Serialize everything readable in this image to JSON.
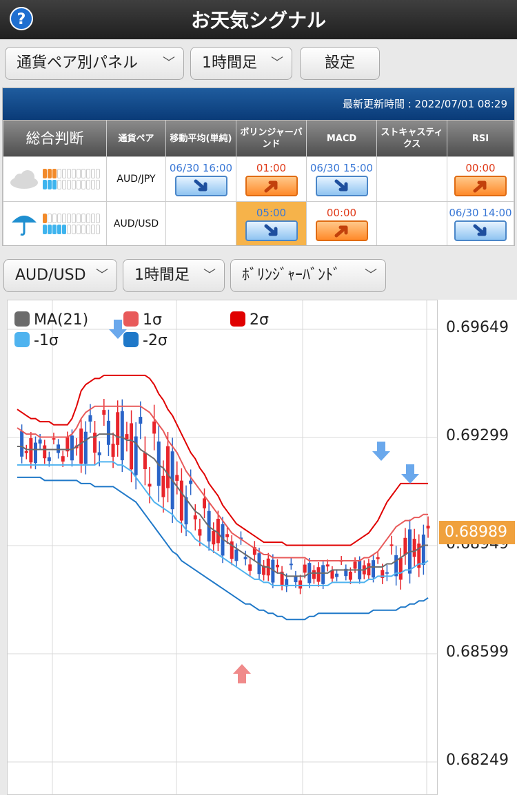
{
  "app": {
    "title": "お天気シグナル",
    "help_icon": "?"
  },
  "controls": {
    "panel_select": "通貨ペア別パネル",
    "timeframe_select": "1時間足",
    "settings_button": "設定"
  },
  "panel": {
    "update_time": "最新更新時間 : 2022/07/01 08:29",
    "headers": {
      "overall": "総合判断",
      "pair": "通貨ペア",
      "ma": "移動平均(単純)",
      "bb": "ボリンジャーバンド",
      "macd": "MACD",
      "stoch": "ストキャスティクス",
      "rsi": "RSI"
    },
    "rows": [
      {
        "weather": "cloud-icon",
        "pair": "AUD/JPY",
        "ma_time": "06/30 16:00",
        "bb_time": "01:00",
        "macd_time": "06/30 15:00",
        "stoch_time": "",
        "rsi_time": "00:00"
      },
      {
        "weather": "umbrella-icon",
        "pair": "AUD/USD",
        "ma_time": "",
        "bb_time": "05:00",
        "macd_time": "00:00",
        "stoch_time": "",
        "rsi_time": "06/30 14:00"
      }
    ]
  },
  "chart_controls": {
    "pair_select": "AUD/USD",
    "timeframe_select": "1時間足",
    "indicator_select": "ﾎﾞﾘﾝｼﾞｬｰﾊﾞﾝﾄﾞ"
  },
  "chart_data": {
    "type": "line",
    "legend": [
      "MA(21)",
      "1σ",
      "2σ",
      "-1σ",
      "-2σ"
    ],
    "legend_colors": [
      "#6b6b6b",
      "#e85a5a",
      "#e00000",
      "#4fb3ef",
      "#1f78c8"
    ],
    "y_ticks": [
      "0.69649",
      "0.69299",
      "0.68949",
      "0.68599",
      "0.68249"
    ],
    "current_price": "0.68989",
    "ylim": [
      0.68249,
      0.69649
    ],
    "x": [
      0,
      2,
      4,
      6,
      8,
      10,
      12,
      14,
      16,
      18,
      20,
      22,
      24,
      26,
      28,
      30,
      32,
      34,
      36,
      38,
      40,
      42,
      44,
      46,
      48,
      50,
      52,
      54,
      56,
      58,
      60,
      62,
      64,
      66,
      68,
      70,
      72,
      74,
      76,
      78,
      80,
      82,
      84,
      86,
      88,
      90,
      92,
      94,
      96,
      98,
      100,
      102,
      104,
      106,
      108,
      110,
      112,
      114,
      116,
      118,
      120,
      122,
      124,
      126,
      128,
      130,
      132,
      134,
      136,
      138,
      140,
      142,
      144,
      146,
      148,
      150,
      152,
      154,
      156,
      158,
      160,
      162,
      164,
      166,
      168,
      170,
      172,
      174,
      176,
      178,
      180
    ],
    "series": [
      {
        "name": "MA(21)",
        "values": [
          0.6927,
          0.6927,
          0.6926,
          0.6926,
          0.6926,
          0.6926,
          0.6926,
          0.6926,
          0.6926,
          0.6926,
          0.6926,
          0.6926,
          0.6926,
          0.6927,
          0.6928,
          0.6929,
          0.693,
          0.693,
          0.6931,
          0.6931,
          0.6931,
          0.6931,
          0.693,
          0.693,
          0.6929,
          0.6929,
          0.6928,
          0.6926,
          0.6925,
          0.6924,
          0.6923,
          0.6921,
          0.692,
          0.6918,
          0.6916,
          0.6914,
          0.6912,
          0.691,
          0.6908,
          0.6906,
          0.6905,
          0.6903,
          0.6901,
          0.69,
          0.6899,
          0.6897,
          0.6896,
          0.6895,
          0.6894,
          0.6893,
          0.6892,
          0.6891,
          0.689,
          0.6889,
          0.6888,
          0.6888,
          0.6887,
          0.6886,
          0.6886,
          0.6885,
          0.6885,
          0.6885,
          0.6885,
          0.6885,
          0.6886,
          0.6886,
          0.6886,
          0.6886,
          0.6886,
          0.6887,
          0.6887,
          0.6887,
          0.6887,
          0.6887,
          0.6887,
          0.6887,
          0.6887,
          0.6888,
          0.6888,
          0.6888,
          0.6888,
          0.6889,
          0.6889,
          0.689,
          0.6891,
          0.6892,
          0.6893,
          0.6893,
          0.6894,
          0.6895,
          0.6895
        ]
      },
      {
        "name": "1σ",
        "values": [
          0.6933,
          0.6932,
          0.6931,
          0.6931,
          0.6931,
          0.693,
          0.693,
          0.693,
          0.693,
          0.693,
          0.693,
          0.693,
          0.6931,
          0.6933,
          0.6936,
          0.6938,
          0.6939,
          0.694,
          0.694,
          0.694,
          0.694,
          0.694,
          0.694,
          0.694,
          0.694,
          0.694,
          0.694,
          0.694,
          0.6939,
          0.6938,
          0.6936,
          0.6934,
          0.6932,
          0.6929,
          0.6927,
          0.6925,
          0.6922,
          0.6919,
          0.6917,
          0.6915,
          0.6913,
          0.6911,
          0.6909,
          0.6907,
          0.6905,
          0.6903,
          0.6901,
          0.6899,
          0.6898,
          0.6897,
          0.6896,
          0.6895,
          0.6894,
          0.6893,
          0.6892,
          0.6892,
          0.6891,
          0.6891,
          0.6891,
          0.6891,
          0.6891,
          0.6891,
          0.6891,
          0.6891,
          0.689,
          0.689,
          0.689,
          0.689,
          0.689,
          0.689,
          0.689,
          0.689,
          0.689,
          0.689,
          0.689,
          0.689,
          0.6891,
          0.6891,
          0.6892,
          0.6893,
          0.6895,
          0.6897,
          0.6899,
          0.6901,
          0.6902,
          0.6903,
          0.6903,
          0.6904,
          0.6904,
          0.6905,
          0.6905
        ]
      },
      {
        "name": "2σ",
        "values": [
          0.6939,
          0.6938,
          0.6937,
          0.6936,
          0.6936,
          0.6935,
          0.6935,
          0.6935,
          0.6934,
          0.6934,
          0.6934,
          0.6934,
          0.6936,
          0.694,
          0.6945,
          0.6947,
          0.6948,
          0.6949,
          0.6949,
          0.695,
          0.695,
          0.695,
          0.695,
          0.695,
          0.695,
          0.695,
          0.695,
          0.695,
          0.695,
          0.6949,
          0.6947,
          0.6944,
          0.6942,
          0.6939,
          0.6937,
          0.6934,
          0.6931,
          0.6928,
          0.6925,
          0.6923,
          0.692,
          0.6918,
          0.6915,
          0.6913,
          0.6911,
          0.6908,
          0.6906,
          0.6904,
          0.6902,
          0.6901,
          0.69,
          0.6899,
          0.6898,
          0.6897,
          0.6896,
          0.6896,
          0.6896,
          0.6896,
          0.6896,
          0.6895,
          0.6895,
          0.6895,
          0.6895,
          0.6895,
          0.6895,
          0.6895,
          0.6895,
          0.6895,
          0.6895,
          0.6895,
          0.6895,
          0.6895,
          0.6895,
          0.6895,
          0.6896,
          0.6897,
          0.6898,
          0.6899,
          0.6901,
          0.6903,
          0.6906,
          0.6909,
          0.6911,
          0.6913,
          0.6915,
          0.6915,
          0.6915,
          0.6915,
          0.6915,
          0.6915,
          0.6915
        ]
      },
      {
        "name": "-1σ",
        "values": [
          0.6921,
          0.6921,
          0.6921,
          0.6921,
          0.6921,
          0.6921,
          0.6921,
          0.6921,
          0.6921,
          0.6921,
          0.6921,
          0.6921,
          0.6921,
          0.6921,
          0.6921,
          0.6921,
          0.6921,
          0.6921,
          0.6922,
          0.6922,
          0.6922,
          0.6922,
          0.6921,
          0.6921,
          0.692,
          0.6919,
          0.6917,
          0.6915,
          0.6913,
          0.6911,
          0.6909,
          0.6908,
          0.6907,
          0.6906,
          0.6905,
          0.6903,
          0.6902,
          0.69,
          0.6899,
          0.6897,
          0.6896,
          0.6895,
          0.6894,
          0.6893,
          0.6892,
          0.6891,
          0.689,
          0.6889,
          0.6888,
          0.6887,
          0.6886,
          0.6885,
          0.6884,
          0.6884,
          0.6883,
          0.6883,
          0.6882,
          0.6882,
          0.6882,
          0.6882,
          0.6882,
          0.6882,
          0.6882,
          0.6882,
          0.6882,
          0.6882,
          0.6882,
          0.6882,
          0.6882,
          0.6883,
          0.6883,
          0.6883,
          0.6883,
          0.6883,
          0.6883,
          0.6883,
          0.6883,
          0.6884,
          0.6884,
          0.6885,
          0.6885,
          0.6885,
          0.6885,
          0.6886,
          0.6886,
          0.6887,
          0.6887,
          0.6888,
          0.6889,
          0.6889,
          0.689
        ]
      },
      {
        "name": "-2σ",
        "values": [
          0.6917,
          0.6917,
          0.6917,
          0.6917,
          0.6917,
          0.6917,
          0.6916,
          0.6916,
          0.6916,
          0.6916,
          0.6916,
          0.6916,
          0.6916,
          0.6916,
          0.6915,
          0.6915,
          0.6915,
          0.6914,
          0.6914,
          0.6914,
          0.6914,
          0.6914,
          0.6913,
          0.6912,
          0.6911,
          0.691,
          0.6909,
          0.6907,
          0.6905,
          0.6903,
          0.6901,
          0.6899,
          0.6897,
          0.6895,
          0.6893,
          0.6892,
          0.689,
          0.6889,
          0.6888,
          0.6887,
          0.6886,
          0.6885,
          0.6884,
          0.6883,
          0.6882,
          0.6881,
          0.688,
          0.6879,
          0.6878,
          0.6877,
          0.6876,
          0.6876,
          0.6875,
          0.6874,
          0.6874,
          0.6873,
          0.6873,
          0.6872,
          0.6872,
          0.6871,
          0.6871,
          0.6871,
          0.6871,
          0.6871,
          0.6872,
          0.6872,
          0.6873,
          0.6873,
          0.6873,
          0.6873,
          0.6873,
          0.6873,
          0.6873,
          0.6873,
          0.6873,
          0.6873,
          0.6873,
          0.6873,
          0.6874,
          0.6874,
          0.6874,
          0.6874,
          0.6874,
          0.6874,
          0.6875,
          0.6875,
          0.6876,
          0.6876,
          0.6877,
          0.6877,
          0.6878
        ]
      }
    ],
    "grid": true,
    "legend_position": "top-left"
  },
  "colors": {
    "up_candle": "#e8252b",
    "down_candle": "#2a64c8",
    "signal_up_arrow": "#f08a8a",
    "signal_down_arrow": "#6aa8ec"
  }
}
